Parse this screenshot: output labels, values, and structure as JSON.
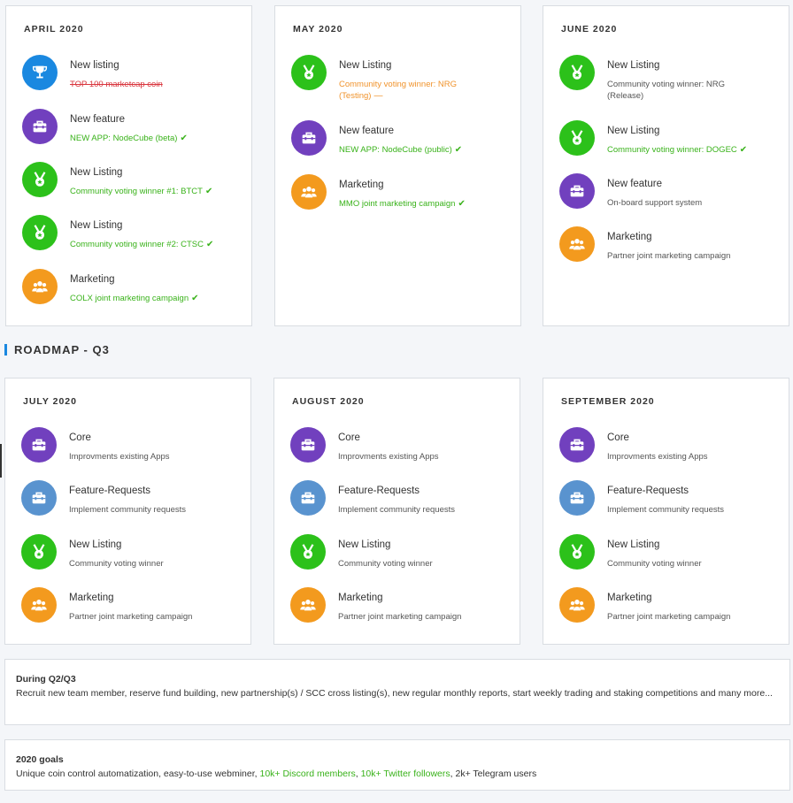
{
  "q2_months": [
    {
      "title": "APRIL 2020",
      "items": [
        {
          "icon": "trophy-icon",
          "color": "#1a88e0",
          "title": "New listing",
          "sub": "TOP 100 marketcap coin",
          "status": "struck",
          "mark": ""
        },
        {
          "icon": "toolbox-icon",
          "color": "#7140be",
          "title": "New feature",
          "sub": "NEW APP: NodeCube (beta)",
          "status": "done",
          "mark": "✔"
        },
        {
          "icon": "medal-icon",
          "color": "#2cc11a",
          "title": "New Listing",
          "sub": "Community voting winner #1: BTCT",
          "status": "done",
          "mark": "✔"
        },
        {
          "icon": "medal-icon",
          "color": "#2cc11a",
          "title": "New Listing",
          "sub": "Community voting winner #2: CTSC",
          "status": "done",
          "mark": "✔"
        },
        {
          "icon": "people-icon",
          "color": "#f39a1e",
          "title": "Marketing",
          "sub": "COLX joint marketing campaign",
          "status": "done",
          "mark": "✔"
        }
      ]
    },
    {
      "title": "MAY 2020",
      "items": [
        {
          "icon": "medal-icon",
          "color": "#2cc11a",
          "title": "New Listing",
          "sub": "Community voting winner: NRG",
          "sub2": "(Testing)",
          "status": "pending",
          "mark": "—"
        },
        {
          "icon": "toolbox-icon",
          "color": "#7140be",
          "title": "New feature",
          "sub": "NEW APP: NodeCube (public)",
          "status": "done",
          "mark": "✔"
        },
        {
          "icon": "people-icon",
          "color": "#f39a1e",
          "title": "Marketing",
          "sub": "MMO joint marketing campaign",
          "status": "done",
          "mark": "✔"
        }
      ]
    },
    {
      "title": "JUNE 2020",
      "items": [
        {
          "icon": "medal-icon",
          "color": "#2cc11a",
          "title": "New Listing",
          "sub": "Community voting winner: NRG",
          "sub2": "(Release)",
          "status": "planned",
          "mark": ""
        },
        {
          "icon": "medal-icon",
          "color": "#2cc11a",
          "title": "New Listing",
          "sub": "Community voting winner: DOGEC",
          "status": "done",
          "mark": "✔"
        },
        {
          "icon": "toolbox-icon",
          "color": "#7140be",
          "title": "New feature",
          "sub": "On-board support system",
          "status": "planned",
          "mark": ""
        },
        {
          "icon": "people-icon",
          "color": "#f39a1e",
          "title": "Marketing",
          "sub": "Partner joint marketing campaign",
          "status": "planned",
          "mark": ""
        }
      ]
    }
  ],
  "section": {
    "title": "ROADMAP - Q3"
  },
  "q3_months": [
    {
      "title": "JULY 2020",
      "items": [
        {
          "icon": "toolbox-icon",
          "color": "#7140be",
          "title": "Core",
          "sub": "Improvments existing Apps",
          "status": "planned",
          "mark": ""
        },
        {
          "icon": "toolbox-icon",
          "color": "#5993cf",
          "title": "Feature-Requests",
          "sub": "Implement community requests",
          "status": "planned",
          "mark": ""
        },
        {
          "icon": "medal-icon",
          "color": "#2cc11a",
          "title": "New Listing",
          "sub": "Community voting winner",
          "status": "planned",
          "mark": ""
        },
        {
          "icon": "people-icon",
          "color": "#f39a1e",
          "title": "Marketing",
          "sub": "Partner joint marketing campaign",
          "status": "planned",
          "mark": ""
        }
      ]
    },
    {
      "title": "AUGUST 2020",
      "items": [
        {
          "icon": "toolbox-icon",
          "color": "#7140be",
          "title": "Core",
          "sub": "Improvments existing Apps",
          "status": "planned",
          "mark": ""
        },
        {
          "icon": "toolbox-icon",
          "color": "#5993cf",
          "title": "Feature-Requests",
          "sub": "Implement community requests",
          "status": "planned",
          "mark": ""
        },
        {
          "icon": "medal-icon",
          "color": "#2cc11a",
          "title": "New Listing",
          "sub": "Community voting winner",
          "status": "planned",
          "mark": ""
        },
        {
          "icon": "people-icon",
          "color": "#f39a1e",
          "title": "Marketing",
          "sub": "Partner joint marketing campaign",
          "status": "planned",
          "mark": ""
        }
      ]
    },
    {
      "title": "SEPTEMBER 2020",
      "items": [
        {
          "icon": "toolbox-icon",
          "color": "#7140be",
          "title": "Core",
          "sub": "Improvments existing Apps",
          "status": "planned",
          "mark": ""
        },
        {
          "icon": "toolbox-icon",
          "color": "#5993cf",
          "title": "Feature-Requests",
          "sub": "Implement community requests",
          "status": "planned",
          "mark": ""
        },
        {
          "icon": "medal-icon",
          "color": "#2cc11a",
          "title": "New Listing",
          "sub": "Community voting winner",
          "status": "planned",
          "mark": ""
        },
        {
          "icon": "people-icon",
          "color": "#f39a1e",
          "title": "Marketing",
          "sub": "Partner joint marketing campaign",
          "status": "planned",
          "mark": ""
        }
      ]
    }
  ],
  "during": {
    "title": "During Q2/Q3",
    "text": "Recruit new team member, reserve fund building, new partnership(s) / SCC cross listing(s), new regular monthly reports, start weekly trading and staking competitions and many more..."
  },
  "goals": {
    "title": "2020 goals",
    "text_1": "Unique coin control automatization, easy-to-use webminer, ",
    "highlight_1": "10k+ Discord members",
    "sep_1": ", ",
    "highlight_2": "10k+ Twitter followers",
    "sep_2": ", 2k+ Telegram users"
  },
  "colors": {
    "green": "#39b21a",
    "orange": "#f0932c",
    "red": "#d9363e",
    "accent": "#1a88e0"
  }
}
